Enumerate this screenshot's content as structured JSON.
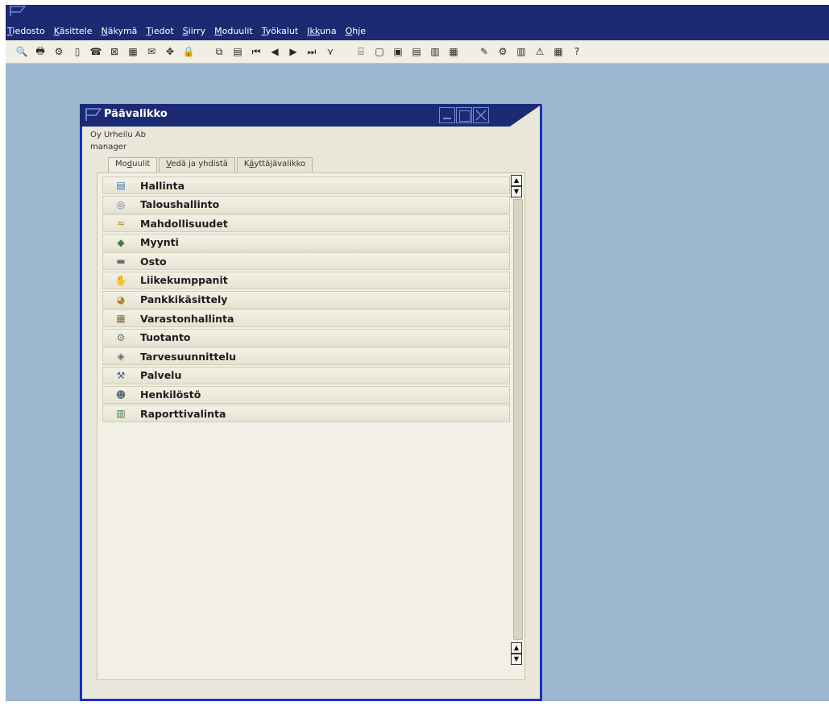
{
  "menubar": {
    "items": [
      {
        "first": "T",
        "rest": "iedosto"
      },
      {
        "first": "K",
        "rest": "äsittele"
      },
      {
        "first": "N",
        "rest": "äkymä"
      },
      {
        "first": "T",
        "rest": "iedot"
      },
      {
        "first": "S",
        "rest": "iirry"
      },
      {
        "first": "M",
        "rest": "oduulit"
      },
      {
        "first": "T",
        "rest": "yökalut"
      },
      {
        "first": "Ikk",
        "rest": "una",
        "underline_first": false,
        "ul": "u"
      },
      {
        "first": "O",
        "rest": "hje"
      }
    ]
  },
  "toolbar": {
    "icons": [
      "print-preview-icon",
      "print-icon",
      "copy-icon",
      "spacer-icon",
      "fax-icon",
      "excel-icon",
      "word-icon",
      "email-icon",
      "arrows-icon",
      "lock-icon",
      "find-icon",
      "first-record-icon",
      "previous-icon",
      "back-icon",
      "next-icon",
      "last-record-icon",
      "filter-icon",
      "sort-icon",
      "document-icon",
      "document-add-icon",
      "document-copy-icon",
      "clip-icon",
      "print-layout-icon",
      "pencil-icon",
      "settings-icon",
      "report-icon",
      "warning-icon",
      "calendar-icon",
      "help-icon"
    ],
    "glyphs": [
      "🔍",
      "🖶",
      "⚙",
      "▯",
      "☎",
      "⊠",
      "▦",
      "✉",
      "✥",
      "🔒",
      "⧉",
      "▤",
      "⏮",
      "◀",
      "▶",
      "⏭",
      "⋎",
      "⌸",
      "▢",
      "▣",
      "▤",
      "▥",
      "▦",
      "✎",
      "⚙",
      "▥",
      "⚠",
      "▦",
      "?"
    ]
  },
  "window": {
    "title": "Päävalikko",
    "company": "Oy Urheilu Ab",
    "user": "manager",
    "tabs": [
      {
        "first": "Mo",
        "u": "d",
        "rest": "uulit"
      },
      {
        "first": "",
        "u": "V",
        "rest": "edä ja yhdistä"
      },
      {
        "first": "K",
        "u": "ä",
        "rest": "yttäjävalikko"
      }
    ]
  },
  "modules": [
    {
      "label": "Hallinta",
      "icon": "▤",
      "icon_name": "administration-icon",
      "color": "#4a6ea8"
    },
    {
      "label": "Taloushallinto",
      "icon": "◎",
      "icon_name": "financials-icon",
      "color": "#5f7a8c"
    },
    {
      "label": "Mahdollisuudet",
      "icon": "≈",
      "icon_name": "opportunities-icon",
      "color": "#b8860b"
    },
    {
      "label": "Myynti",
      "icon": "◆",
      "icon_name": "sales-icon",
      "color": "#3f7f3f"
    },
    {
      "label": "Osto",
      "icon": "▬",
      "icon_name": "purchasing-icon",
      "color": "#6d6d6d"
    },
    {
      "label": "Liikekumppanit",
      "icon": "✋",
      "icon_name": "business-partners-icon",
      "color": "#9b6b3a"
    },
    {
      "label": "Pankkikäsittely",
      "icon": "◕",
      "icon_name": "banking-icon",
      "color": "#b08a2a"
    },
    {
      "label": "Varastonhallinta",
      "icon": "▦",
      "icon_name": "inventory-icon",
      "color": "#8a6a3a"
    },
    {
      "label": "Tuotanto",
      "icon": "⚙",
      "icon_name": "production-icon",
      "color": "#777777"
    },
    {
      "label": "Tarvesuunnittelu",
      "icon": "◈",
      "icon_name": "mrp-icon",
      "color": "#5a6a7a"
    },
    {
      "label": "Palvelu",
      "icon": "⚒",
      "icon_name": "service-icon",
      "color": "#4a5a8a"
    },
    {
      "label": "Henkilöstö",
      "icon": "☻",
      "icon_name": "human-resources-icon",
      "color": "#5a6b7b"
    },
    {
      "label": "Raporttivalinta",
      "icon": "▥",
      "icon_name": "reports-icon",
      "color": "#3f7f3f"
    }
  ]
}
